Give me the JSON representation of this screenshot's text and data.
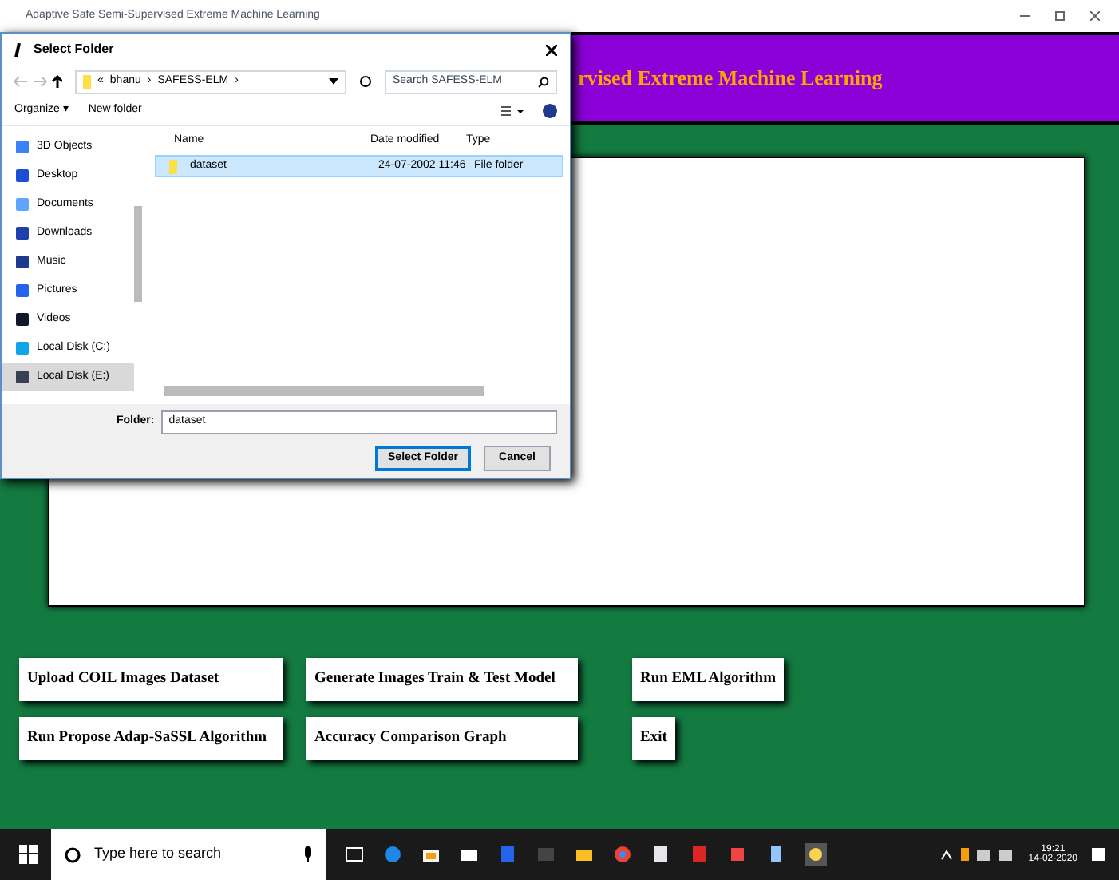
{
  "window": {
    "title": "Adaptive Safe Semi-Supervised Extreme Machine Learning"
  },
  "header": {
    "title": "rvised Extreme Machine Learning"
  },
  "buttons": [
    [
      "Upload COIL Images Dataset",
      "Generate Images Train & Test Model",
      "Run EML Algorithm"
    ],
    [
      "Run Propose Adap-SaSSL Algorithm",
      "Accuracy Comparison Graph",
      "Exit"
    ]
  ],
  "dialog": {
    "title": "Select Folder",
    "breadcrumb": [
      "«",
      "bhanu",
      "›",
      "SAFESS-ELM",
      "›"
    ],
    "search_placeholder": "Search SAFESS-ELM",
    "toolbar": [
      "Organize ▾",
      "New folder"
    ],
    "sidebar": [
      {
        "label": "3D Objects",
        "selected": false
      },
      {
        "label": "Desktop",
        "selected": false
      },
      {
        "label": "Documents",
        "selected": false
      },
      {
        "label": "Downloads",
        "selected": false
      },
      {
        "label": "Music",
        "selected": false
      },
      {
        "label": "Pictures",
        "selected": false
      },
      {
        "label": "Videos",
        "selected": false
      },
      {
        "label": "Local Disk (C:)",
        "selected": false
      },
      {
        "label": "Local Disk (E:)",
        "selected": true
      }
    ],
    "columns": [
      "Name",
      "Date modified",
      "Type"
    ],
    "rows": [
      {
        "name": "dataset",
        "date": "24-07-2002 11:46",
        "type": "File folder",
        "selected": true
      }
    ],
    "folder_label": "Folder:",
    "folder_value": "dataset",
    "actions": [
      "Select Folder",
      "Cancel"
    ]
  },
  "taskbar": {
    "search_placeholder": "Type here to search",
    "time": "19:21",
    "date": "14-02-2020"
  }
}
